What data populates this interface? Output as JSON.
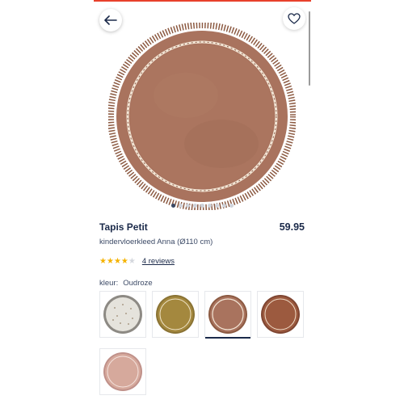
{
  "product": {
    "brand": "Tapis Petit",
    "price": "59.95",
    "subtitle": "kindervloerkleed Anna (Ø110 cm)",
    "rating": 4,
    "rating_max": 5,
    "reviews_label": "4 reviews"
  },
  "gallery": {
    "image_count": 9,
    "active_index": 0,
    "main_image_color": "#a9735e"
  },
  "color": {
    "label": "kleur:",
    "selected": "Oudroze",
    "swatches": [
      {
        "id": "grey-dots",
        "color": "#e5e3dc",
        "selected": false
      },
      {
        "id": "olive",
        "color": "#a4883e",
        "selected": false
      },
      {
        "id": "oudroze",
        "color": "#a9735e",
        "selected": true
      },
      {
        "id": "brown",
        "color": "#9c5a3f",
        "selected": false
      },
      {
        "id": "pink",
        "color": "#d6a99c",
        "selected": false
      }
    ]
  },
  "colors": {
    "text_primary": "#1b2a4a",
    "accent_red": "#e8412c",
    "star": "#f5b301"
  },
  "icons": {
    "back": "arrow-left-icon",
    "favorite": "heart-icon"
  }
}
